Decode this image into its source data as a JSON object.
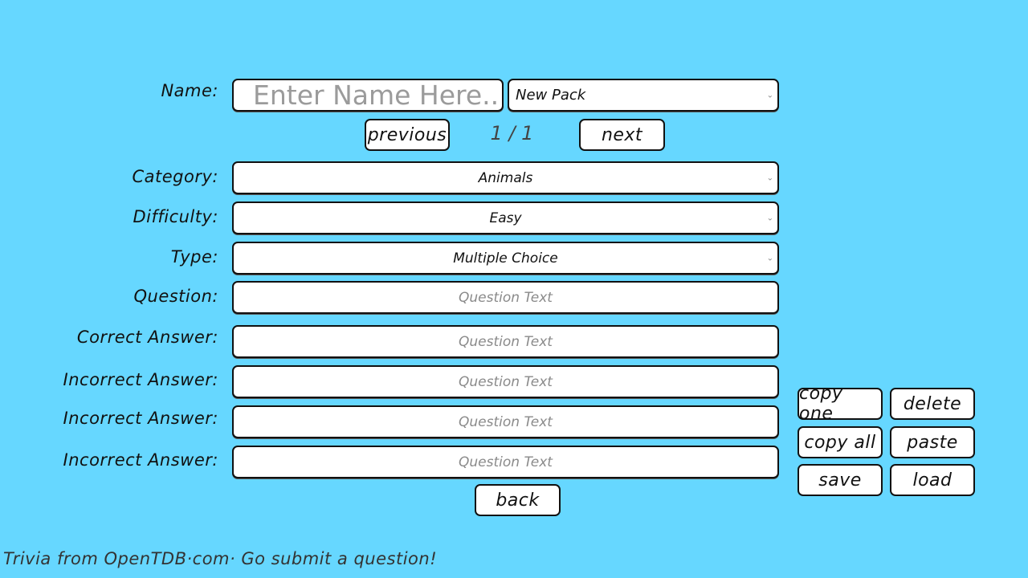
{
  "name_row": {
    "label": "Name:",
    "name_placeholder": "Enter Name Here..",
    "pack_select_value": "New Pack"
  },
  "pager": {
    "previous_label": "previous",
    "page_indicator": "1 / 1",
    "next_label": "next"
  },
  "fields": {
    "category": {
      "label": "Category:",
      "value": "Animals"
    },
    "difficulty": {
      "label": "Difficulty:",
      "value": "Easy"
    },
    "type": {
      "label": "Type:",
      "value": "Multiple Choice"
    },
    "question": {
      "label": "Question:",
      "placeholder": "Question Text"
    },
    "correct_answer": {
      "label": "Correct Answer:",
      "placeholder": "Question Text"
    },
    "incorrect_answers": [
      {
        "label": "Incorrect Answer:",
        "placeholder": "Question Text"
      },
      {
        "label": "Incorrect Answer:",
        "placeholder": "Question Text"
      },
      {
        "label": "Incorrect Answer:",
        "placeholder": "Question Text"
      }
    ]
  },
  "actions": {
    "copy_one": "copy one",
    "delete": "delete",
    "copy_all": "copy all",
    "paste": "paste",
    "save": "save",
    "load": "load",
    "back": "back"
  },
  "footer": {
    "credit": "Trivia from OpenTDB·com· Go submit a question!"
  },
  "icons": {
    "dropdown": "chevron-down-icon"
  },
  "colors": {
    "background": "#66d7ff",
    "field_bg": "#ffffff",
    "border": "#111111",
    "placeholder": "#8a8a8a"
  }
}
